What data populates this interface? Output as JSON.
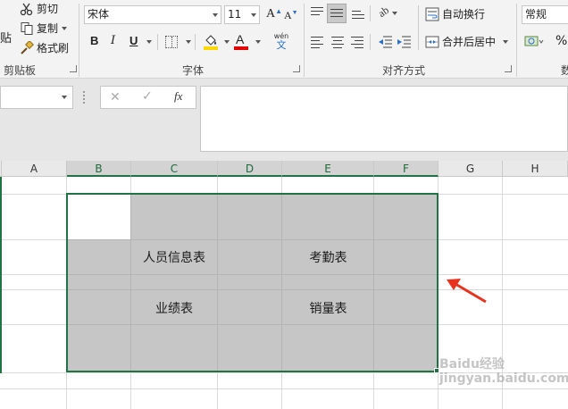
{
  "ribbon": {
    "clipboard": {
      "paste_partial": "贴",
      "cut": "剪切",
      "copy": "复制",
      "format_painter": "格式刷",
      "group_label": "剪贴板"
    },
    "font": {
      "font_name": "宋体",
      "font_size": "11",
      "bold": "B",
      "italic": "I",
      "underline": "U",
      "phonetic_top": "wén",
      "phonetic_bottom": "文",
      "group_label": "字体",
      "fill_color": "#ffd700",
      "font_color": "#e00000"
    },
    "alignment": {
      "wrap_text": "自动换行",
      "merge_center": "合并后居中",
      "group_label": "对齐方式"
    },
    "number": {
      "format": "常规",
      "percent": "%",
      "group_label_partial": "数"
    }
  },
  "formula_bar": {
    "cancel": "✕",
    "enter": "✓",
    "fx": "fx"
  },
  "columns": [
    {
      "label": "A",
      "selected": false
    },
    {
      "label": "B",
      "selected": true
    },
    {
      "label": "C",
      "selected": true
    },
    {
      "label": "D",
      "selected": true
    },
    {
      "label": "E",
      "selected": true
    },
    {
      "label": "F",
      "selected": true
    },
    {
      "label": "G",
      "selected": false
    },
    {
      "label": "H",
      "selected": false
    }
  ],
  "cells": {
    "personnel": "人员信息表",
    "attendance": "考勤表",
    "performance": "业绩表",
    "sales": "销量表"
  },
  "accent_color": "#217346",
  "selection_fill": "#c6c6c6",
  "arrow_color": "#e8321e",
  "watermark": "Baidu经验 jingyan.baidu.com"
}
